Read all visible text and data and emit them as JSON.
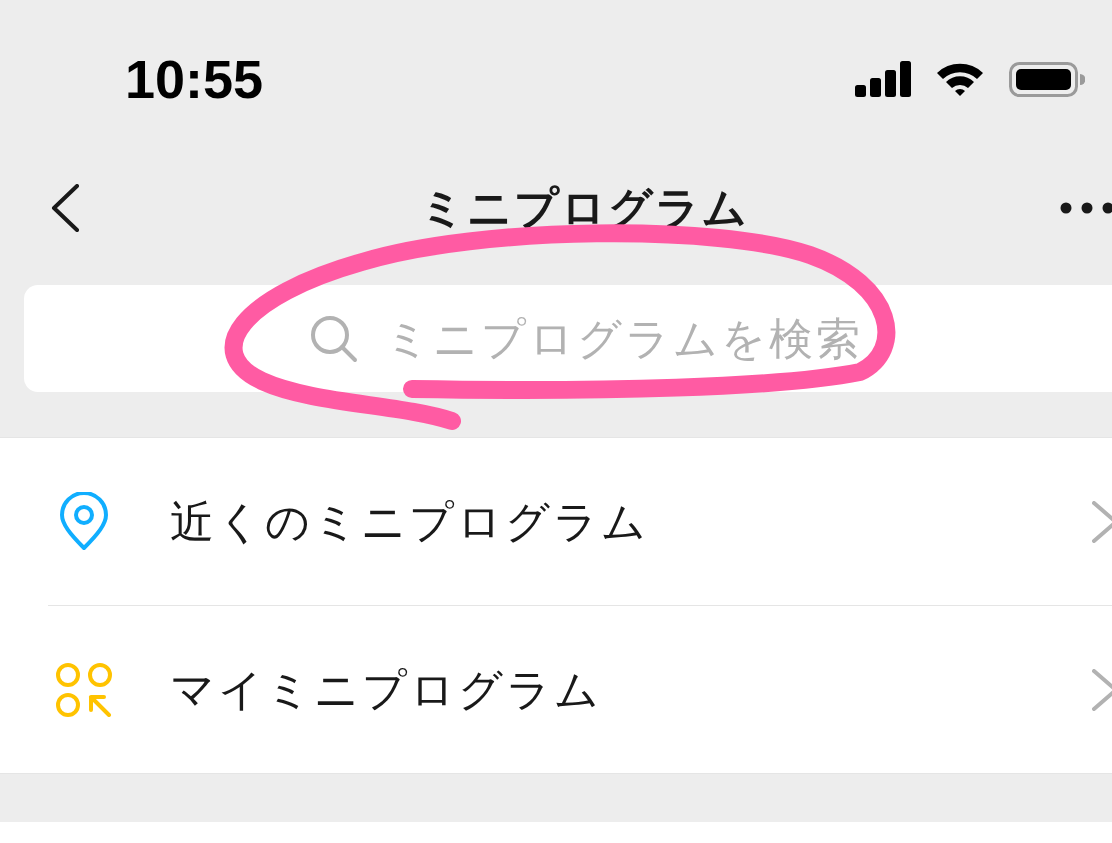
{
  "status_bar": {
    "time": "10:55"
  },
  "nav_bar": {
    "title": "ミニプログラム"
  },
  "search": {
    "placeholder": "ミニプログラムを検索"
  },
  "menu": {
    "items": [
      {
        "label": "近くのミニプログラム",
        "kind": "nearby"
      },
      {
        "label": "マイミニプログラム",
        "kind": "mine"
      }
    ]
  }
}
